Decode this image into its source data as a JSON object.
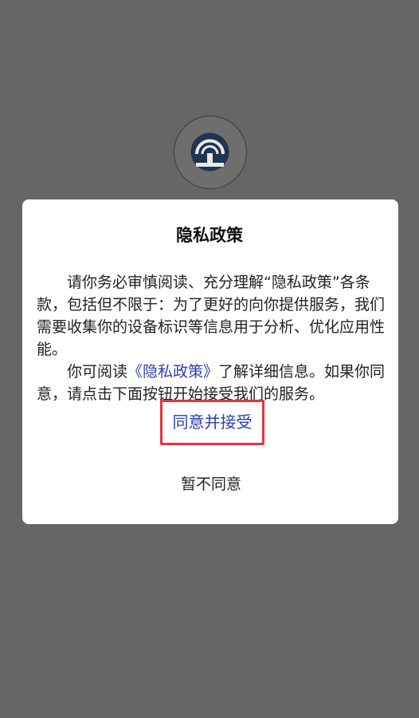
{
  "background_color": "#666666",
  "app_logo": {
    "icon": "railway-logo-icon"
  },
  "dialog": {
    "title": "隐私政策",
    "paragraph1": "请你务必审慎阅读、充分理解“隐私政策”各条款，包括但不限于：为了更好的向你提供服务，我们需要收集你的设备标识等信息用于分析、优化应用性能。",
    "paragraph2_prefix": "你可阅读",
    "policy_link": "《隐私政策》",
    "paragraph2_suffix": "了解详细信息。如果你同意，请点击下面按钮开始接受我们的服务。",
    "agree_button": "同意并接受",
    "decline_button": "暂不同意",
    "link_color": "#2a3fa8",
    "highlight_color": "#e0353b"
  }
}
